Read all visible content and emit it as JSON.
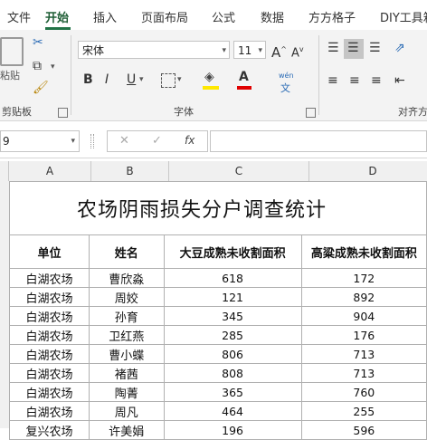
{
  "ribbon_tabs": [
    "文件",
    "开始",
    "插入",
    "页面布局",
    "公式",
    "数据",
    "方方格子",
    "DIY工具箱"
  ],
  "clipboard": {
    "paste_label": "粘贴",
    "group_label": "剪贴板"
  },
  "font": {
    "name": "宋体",
    "size": "11",
    "group_label": "字体",
    "bold": "B",
    "italic": "I",
    "underline": "U",
    "phonetic": "wén"
  },
  "alignment": {
    "group_label": "对齐方式"
  },
  "formula_bar": {
    "name_box": "9",
    "fx": "fx",
    "cancel": "✕",
    "enter": "✓",
    "value": ""
  },
  "columns": [
    "A",
    "B",
    "C",
    "D"
  ],
  "sheet": {
    "title": "农场阴雨损失分户调查统计",
    "headers": [
      "单位",
      "姓名",
      "大豆成熟未收割面积",
      "高粱成熟未收割面积"
    ],
    "rows": [
      [
        "白湖农场",
        "曹欣淼",
        "618",
        "172"
      ],
      [
        "白湖农场",
        "周姣",
        "121",
        "892"
      ],
      [
        "白湖农场",
        "孙育",
        "345",
        "904"
      ],
      [
        "白湖农场",
        "卫红燕",
        "285",
        "176"
      ],
      [
        "白湖农场",
        "曹小蝶",
        "806",
        "713"
      ],
      [
        "白湖农场",
        "褚茜",
        "808",
        "713"
      ],
      [
        "白湖农场",
        "陶菁",
        "365",
        "760"
      ],
      [
        "白湖农场",
        "周凡",
        "464",
        "255"
      ],
      [
        "复兴农场",
        "许美娟",
        "196",
        "596"
      ]
    ]
  }
}
